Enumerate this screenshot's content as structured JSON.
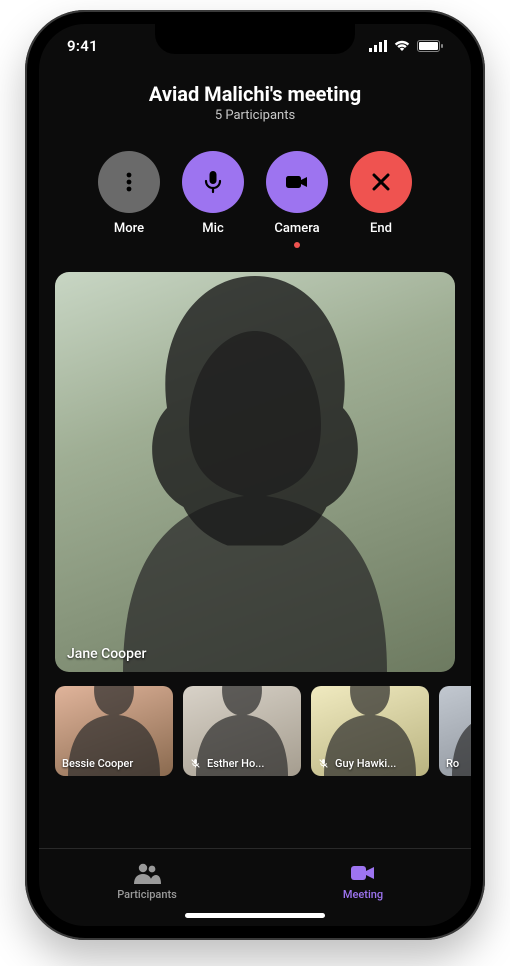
{
  "status": {
    "time": "9:41"
  },
  "header": {
    "title": "Aviad Malichi's meeting",
    "subtitle": "5 Participants"
  },
  "controls": {
    "more": "More",
    "mic": "Mic",
    "camera": "Camera",
    "end": "End"
  },
  "main_participant": {
    "name": "Jane Cooper",
    "muted": false
  },
  "thumbnails": [
    {
      "name": "Bessie Cooper",
      "muted": false
    },
    {
      "name": "Esther Ho...",
      "muted": true
    },
    {
      "name": "Guy Hawki...",
      "muted": true
    },
    {
      "name": "Ro",
      "muted": false
    }
  ],
  "nav": {
    "participants": "Participants",
    "meeting": "Meeting",
    "active": "meeting"
  },
  "colors": {
    "accent": "#9d74f0",
    "danger": "#ef5350"
  }
}
